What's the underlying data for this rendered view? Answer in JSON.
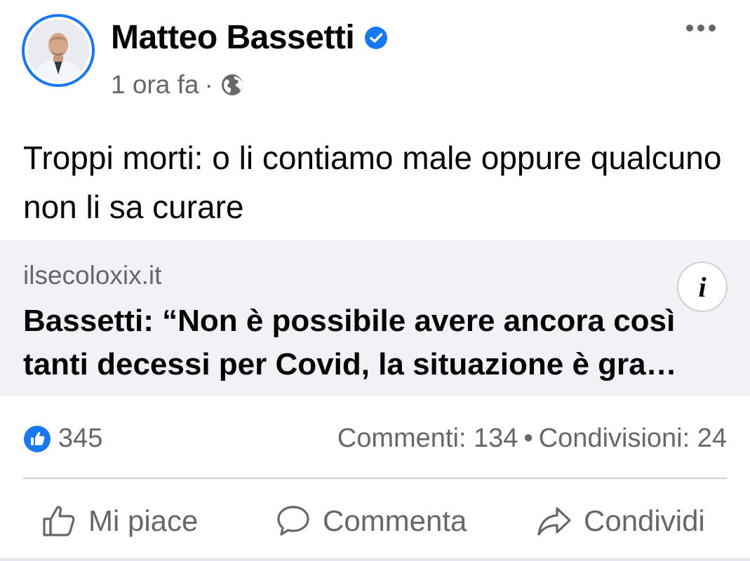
{
  "post": {
    "author": "Matteo Bassetti",
    "verified": true,
    "time": "1 ora fa",
    "separator": "·",
    "privacy_icon": "globe-icon",
    "text": "Troppi morti: o li contiamo male oppure qualcuno non li sa curare"
  },
  "link": {
    "domain": "ilsecoloxix.it",
    "headline": "Bassetti: “Non è possibile avere ancora così tanti decessi per Covid, la situazione è gra…",
    "info_icon": "i"
  },
  "stats": {
    "likes": "345",
    "comments": "Commenti: 134",
    "bullet": "•",
    "shares": "Condivisioni: 24"
  },
  "actions": {
    "like": "Mi piace",
    "comment": "Commenta",
    "share": "Condividi"
  },
  "colors": {
    "accent": "#1877f2",
    "secondary_text": "#65676b",
    "preview_bg": "#f0f2f5"
  }
}
